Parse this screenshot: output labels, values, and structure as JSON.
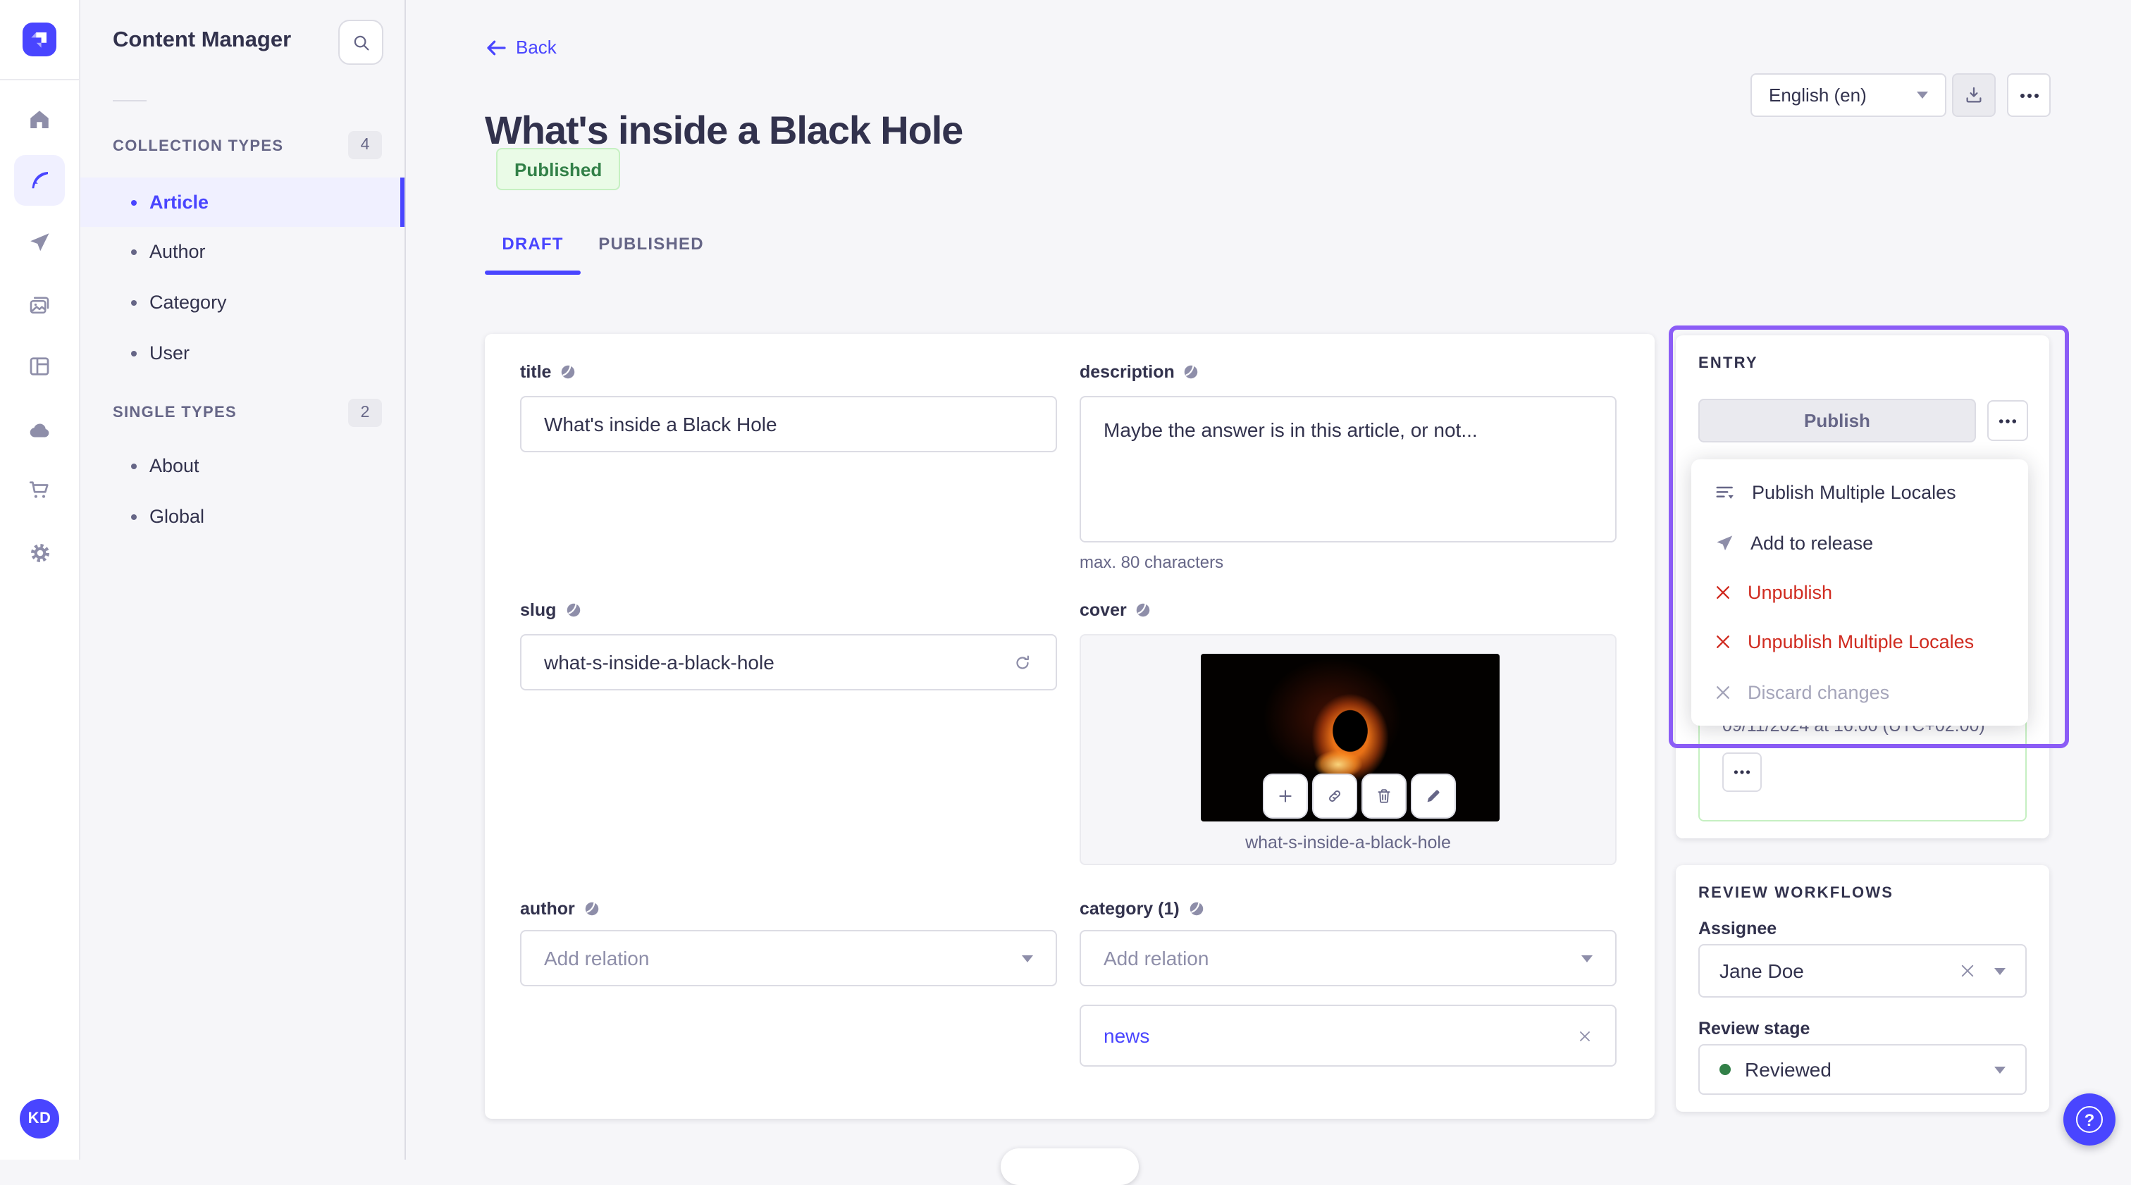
{
  "rail": {
    "avatar_initials": "KD",
    "icons": [
      "strapi-logo",
      "home",
      "content-manager-feather",
      "releases-plane",
      "media-library",
      "content-type-builder",
      "deploy-cloud",
      "marketplace-cart",
      "settings-gear"
    ]
  },
  "sidebar": {
    "title": "Content Manager",
    "search_icon": "magnifier",
    "sections": [
      {
        "label": "COLLECTION TYPES",
        "badge": "4",
        "items": [
          {
            "label": "Article"
          },
          {
            "label": "Author"
          },
          {
            "label": "Category"
          },
          {
            "label": "User"
          }
        ]
      },
      {
        "label": "SINGLE TYPES",
        "badge": "2",
        "items": [
          {
            "label": "About"
          },
          {
            "label": "Global"
          }
        ]
      }
    ]
  },
  "header": {
    "back": "Back",
    "title": "What's inside a Black Hole",
    "status": "Published",
    "locale": "English (en)",
    "tabs": {
      "draft": "DRAFT",
      "published": "PUBLISHED"
    }
  },
  "form": {
    "title": {
      "label": "title",
      "value": "What's inside a Black Hole"
    },
    "description": {
      "label": "description",
      "value": "Maybe the answer is in this article, or not...",
      "helper": "max. 80 characters"
    },
    "slug": {
      "label": "slug",
      "value": "what-s-inside-a-black-hole"
    },
    "cover": {
      "label": "cover",
      "caption": "what-s-inside-a-black-hole",
      "toolbar_icons": [
        "plus",
        "link",
        "trash",
        "pencil"
      ]
    },
    "author": {
      "label": "author",
      "placeholder": "Add relation"
    },
    "category": {
      "label": "category (1)",
      "placeholder": "Add relation",
      "relation": "news"
    }
  },
  "entry": {
    "heading": "ENTRY",
    "publish": "Publish",
    "menu": [
      {
        "label": "Publish Multiple Locales",
        "kind": "default",
        "icon": "list-plus"
      },
      {
        "label": "Add to release",
        "kind": "default",
        "icon": "paper-plane"
      },
      {
        "label": "Unpublish",
        "kind": "danger",
        "icon": "cross"
      },
      {
        "label": "Unpublish Multiple Locales",
        "kind": "danger",
        "icon": "cross"
      },
      {
        "label": "Discard changes",
        "kind": "disabled",
        "icon": "cross"
      }
    ],
    "scheduled_date": "09/11/2024 at 16:00 (UTC+02:00)"
  },
  "review": {
    "heading": "REVIEW WORKFLOWS",
    "assignee_label": "Assignee",
    "assignee_value": "Jane Doe",
    "stage_label": "Review stage",
    "stage_value": "Reviewed"
  },
  "colors": {
    "accent": "#4945ff",
    "danger": "#d02b20",
    "success_text": "#328048",
    "success_bg": "#eafbe7",
    "success_border": "#c6f0c2",
    "annotation": "#8b5cf6",
    "neutral_border": "#dcdce4",
    "muted_text": "#666687"
  }
}
